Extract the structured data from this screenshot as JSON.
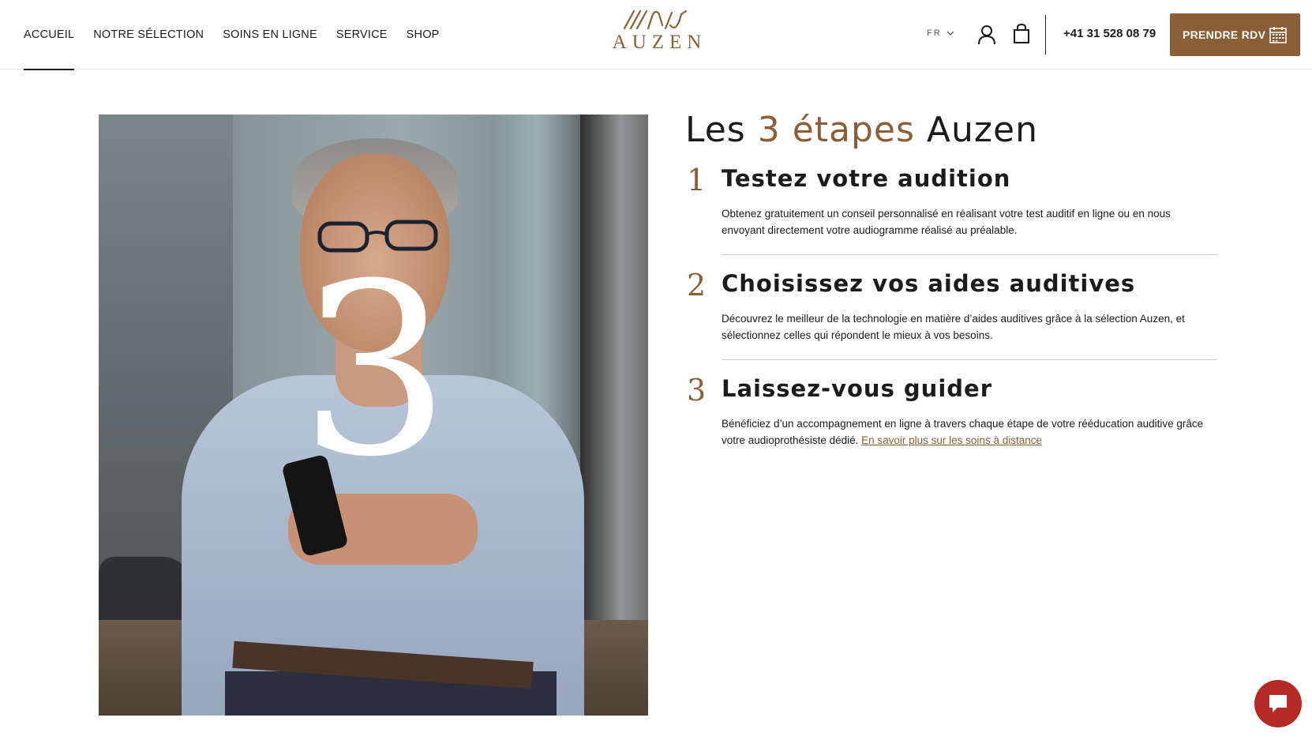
{
  "header": {
    "nav": [
      "ACCUEIL",
      "NOTRE SÉLECTION",
      "SOINS EN LIGNE",
      "SERVICE",
      "SHOP"
    ],
    "logo_text": "AUZEN",
    "language": "FR",
    "phone": "+41 31 528 08 79",
    "cta_label": "PRENDRE RDV"
  },
  "hero": {
    "overlay_number": "3",
    "title_before": "Les ",
    "title_accent": "3 étapes",
    "title_after": " Auzen"
  },
  "steps": [
    {
      "number": "1",
      "title": "Testez votre audition",
      "text": "Obtenez gratuitement un conseil personnalisé en réalisant votre test auditif en ligne ou en nous envoyant directement votre audiogramme réalisé au préalable."
    },
    {
      "number": "2",
      "title": "Choisissez vos aides auditives",
      "text": "Découvrez le meilleur de la technologie en matière d’aides auditives grâce à la sélection Auzen, et sélectionnez celles qui répondent le mieux à vos besoins."
    },
    {
      "number": "3",
      "title": "Laissez-vous guider",
      "text": "Bénéficiez d’un accompagnement en ligne à travers chaque étape de votre rééducation auditive grâce votre audioprothésiste dédié. ",
      "link": "En savoir plus sur les soins à distance"
    }
  ],
  "colors": {
    "accent": "#8a5f35",
    "chat": "#b52a22"
  }
}
